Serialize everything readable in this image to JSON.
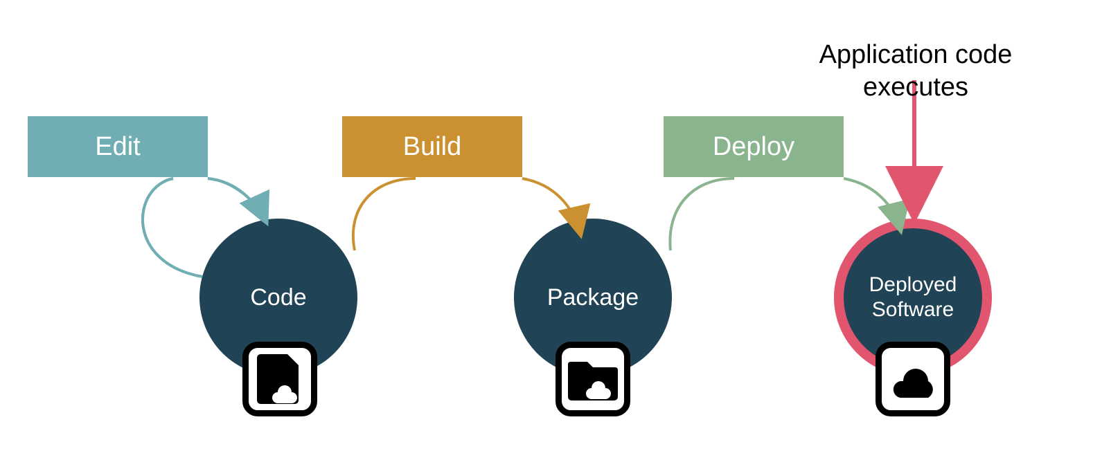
{
  "stages": {
    "edit": {
      "label": "Edit",
      "color": "#71AEB3"
    },
    "build": {
      "label": "Build",
      "color": "#CB9131"
    },
    "deploy": {
      "label": "Deploy",
      "color": "#8AB48E"
    }
  },
  "nodes": {
    "code": {
      "label": "Code"
    },
    "package": {
      "label": "Package"
    },
    "deployed": {
      "label": "Deployed\nSoftware"
    }
  },
  "annotation": {
    "executes": "Application code\nexecutes"
  },
  "colors": {
    "node_bg": "#204455",
    "highlight_ring": "#E2556E",
    "pointer": "#E2556E"
  }
}
